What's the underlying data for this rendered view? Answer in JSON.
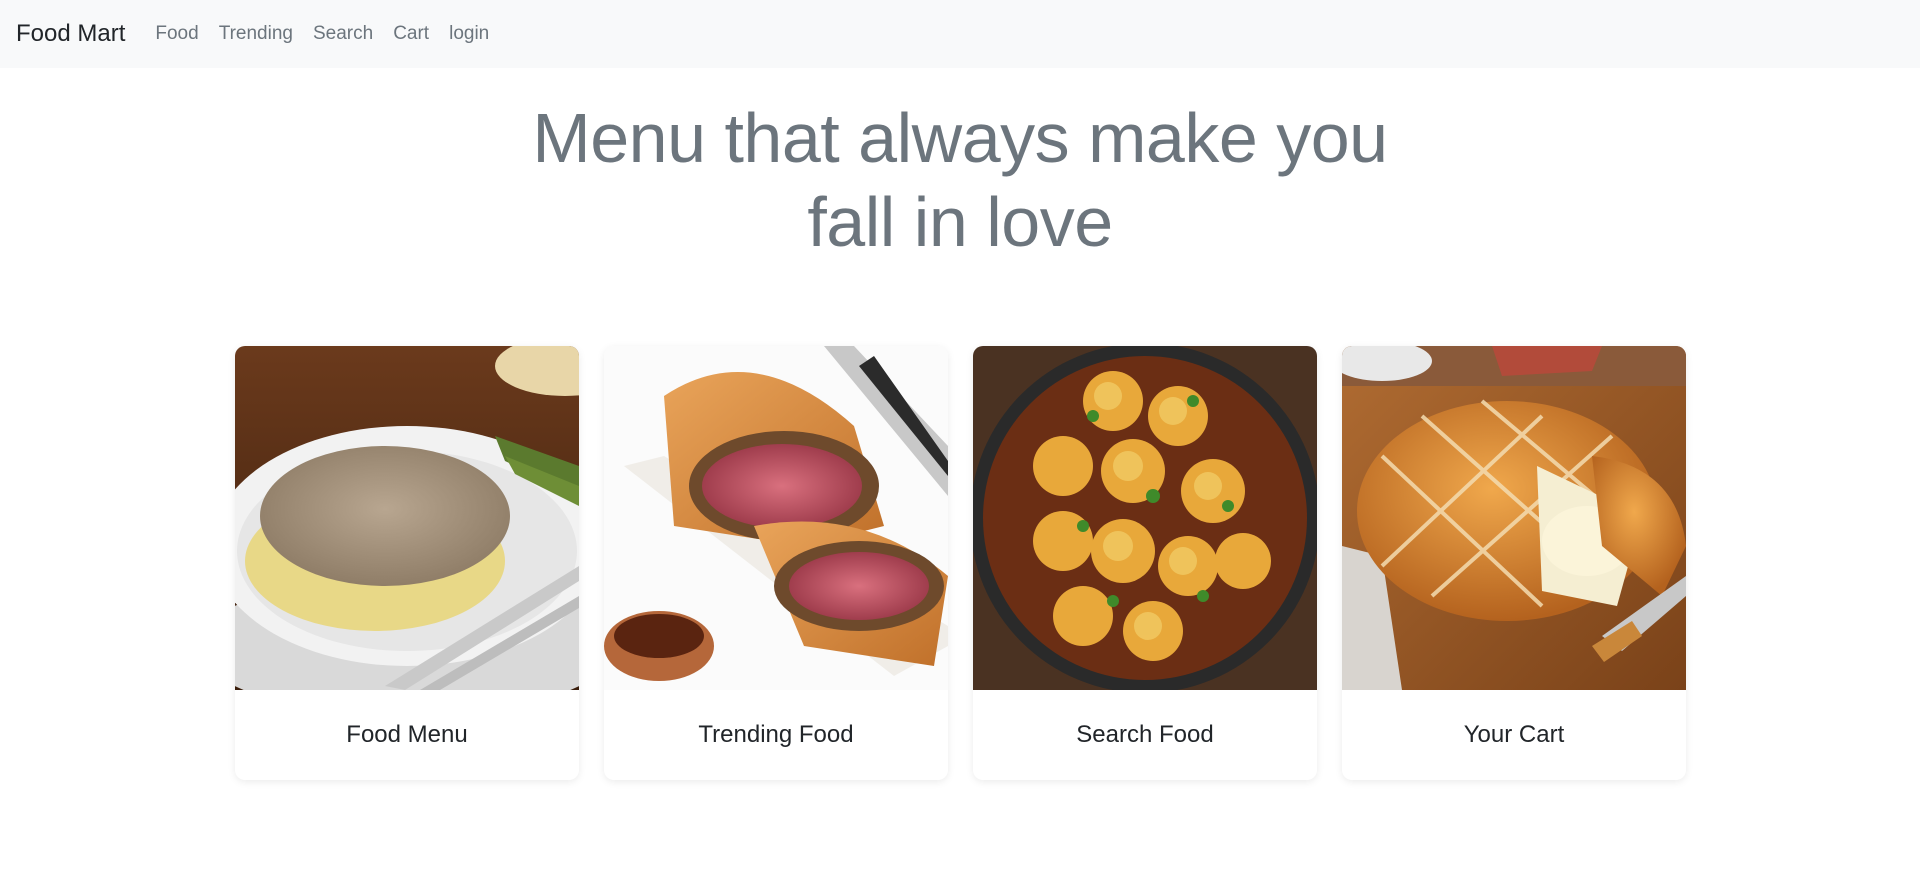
{
  "navbar": {
    "brand": "Food Mart",
    "links": [
      "Food",
      "Trending",
      "Search",
      "Cart",
      "login"
    ]
  },
  "hero": {
    "title_line1": "Menu that always make you",
    "title_line2": "fall in love"
  },
  "cards": [
    {
      "title": "Food Menu",
      "image": "beef-stroganoff-photo"
    },
    {
      "title": "Trending Food",
      "image": "beef-wellington-photo"
    },
    {
      "title": "Search Food",
      "image": "stew-with-dumplings-photo"
    },
    {
      "title": "Your Cart",
      "image": "baked-brie-pastry-photo"
    }
  ],
  "colors": {
    "navbar_bg": "#f8f9fa",
    "nav_link": "#6c757d",
    "hero_text": "#6c757d",
    "card_title": "#212529"
  }
}
